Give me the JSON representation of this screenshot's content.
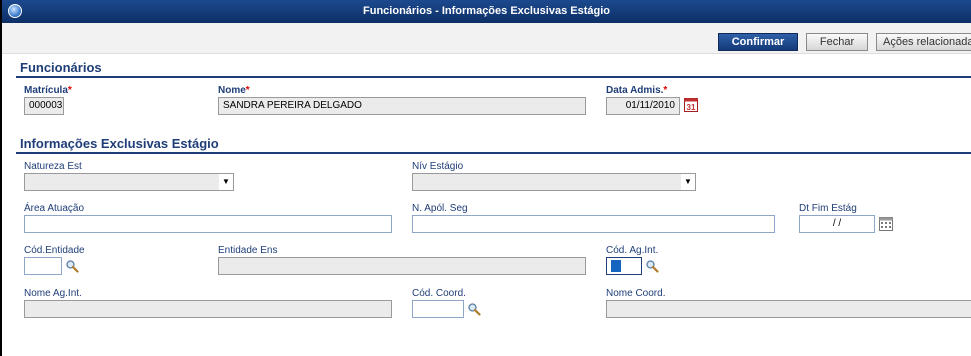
{
  "window": {
    "title": "Funcionários - Informações Exclusivas Estágio"
  },
  "toolbar": {
    "confirm_label": "Confirmar",
    "close_label": "Fechar",
    "actions_label": "Ações relacionadas"
  },
  "section1": {
    "title": "Funcionários",
    "matricula_label": "Matrícula",
    "matricula_value": "000003",
    "nome_label": "Nome",
    "nome_value": "SANDRA PEREIRA DELGADO",
    "data_label": "Data Admis.",
    "data_value": "01/11/2010",
    "required_mark": "*"
  },
  "section2": {
    "title": "Informações Exclusivas Estágio",
    "natureza_label": "Natureza Est",
    "niv_label": "Nív Estágio",
    "area_label": "Área Atuação",
    "apol_label": "N. Apól. Seg",
    "dtfim_label": "Dt Fim Estág",
    "dtfim_value": "/ /",
    "cod_entidade_label": "Cód.Entidade",
    "entidade_label": "Entidade Ens",
    "cod_agint_label": "Cód. Ag.Int.",
    "nome_agint_label": "Nome Ag.Int.",
    "cod_coord_label": "Cód. Coord.",
    "nome_coord_label": "Nome Coord."
  },
  "colors": {
    "title_bar": "#0d2f66",
    "label_blue": "#1f3e78",
    "required_red": "#e00000"
  }
}
